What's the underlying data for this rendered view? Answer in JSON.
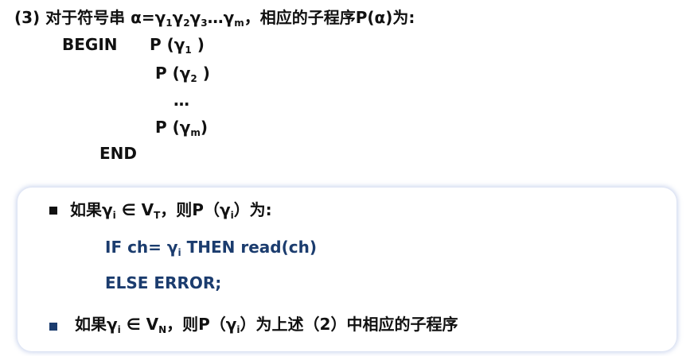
{
  "heading": {
    "prefix": "(3) 对于符号串 α=γ",
    "s1": "1",
    "g2": "γ",
    "s2": "2",
    "g3": "γ",
    "s3": "3",
    "mid": "…γ",
    "sm": "m",
    "suffix": "，相应的子程序P(α)为:"
  },
  "program": {
    "begin": "BEGIN",
    "calls": [
      {
        "text": "P (γ",
        "sub": "1",
        "close": ")"
      },
      {
        "text": "P (γ",
        "sub": "2",
        "close": ")"
      },
      {
        "text": "…",
        "sub": "",
        "close": ""
      },
      {
        "text": "P (γ",
        "sub": "m",
        "close": ")"
      }
    ],
    "end": "END"
  },
  "box": {
    "rule1": {
      "a": "如果γ",
      "i": "i",
      "b": " ∈ V",
      "t": "T",
      "c": "，则P（γ",
      "i2": "i",
      "d": "）为:"
    },
    "code1": {
      "a": "IF ch= γ",
      "i": "i",
      "b": "  THEN read(ch)"
    },
    "code2": "ELSE  ERROR;",
    "rule2": {
      "a": "如果γ",
      "i": "i",
      "b": " ∈ V",
      "n": "N",
      "c": "，则P（γ",
      "i2": "i",
      "d": "）为上述（2）中相应的子程序"
    }
  },
  "colors": {
    "code": "#1b3c6e",
    "bullet2": "#1b3c6e"
  }
}
